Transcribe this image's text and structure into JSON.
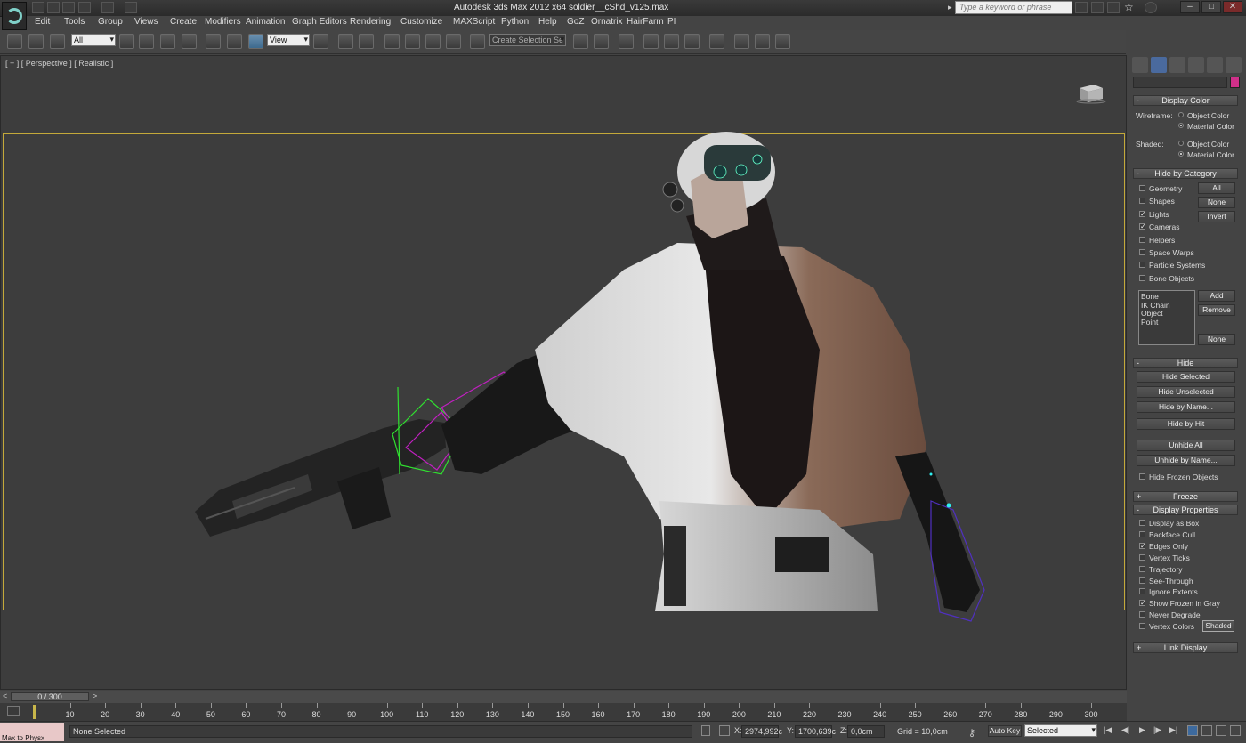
{
  "title_bar": {
    "title": "Autodesk 3ds Max  2012 x64      soldier__cShd_v125.max",
    "search_placeholder": "Type a keyword or phrase"
  },
  "menu": [
    "Edit",
    "Tools",
    "Group",
    "Views",
    "Create",
    "Modifiers",
    "Animation",
    "Graph Editors",
    "Rendering",
    "Customize",
    "MAXScript",
    "Python",
    "Help",
    "GoZ",
    "Ornatrix",
    "HairFarm",
    "PI"
  ],
  "toolbar": {
    "selection_filter": "All",
    "reference_coord": "View",
    "named_selection": "Create Selection Se"
  },
  "viewport": {
    "label": "[ + ] [ Perspective ] [ Realistic ]"
  },
  "timeline": {
    "frame_display": "0 / 300",
    "ticks": [
      "10",
      "20",
      "30",
      "40",
      "50",
      "60",
      "70",
      "80",
      "90",
      "100",
      "110",
      "120",
      "130",
      "140",
      "150",
      "160",
      "170",
      "180",
      "190",
      "200",
      "210",
      "220",
      "230",
      "240",
      "250",
      "260",
      "270",
      "280",
      "290",
      "300"
    ]
  },
  "status": {
    "selection": "None Selected",
    "x_label": "X:",
    "x_value": "2974,992c",
    "y_label": "Y:",
    "y_value": "1700,639c",
    "z_label": "Z:",
    "z_value": "0,0cm",
    "grid": "Grid = 10,0cm",
    "auto_key": "Auto Key",
    "key_filter": "Selected",
    "script_listener": "Max to Physx"
  },
  "command_panel": {
    "color_swatch": "#d0308a",
    "display_color": {
      "title": "Display Color",
      "wireframe_label": "Wireframe:",
      "shaded_label": "Shaded:",
      "object_color": "Object Color",
      "material_color": "Material Color"
    },
    "hide_by_category": {
      "title": "Hide by Category",
      "items": [
        {
          "label": "Geometry",
          "checked": false
        },
        {
          "label": "Shapes",
          "checked": false
        },
        {
          "label": "Lights",
          "checked": true
        },
        {
          "label": "Cameras",
          "checked": true
        },
        {
          "label": "Helpers",
          "checked": false
        },
        {
          "label": "Space Warps",
          "checked": false
        },
        {
          "label": "Particle Systems",
          "checked": false
        },
        {
          "label": "Bone Objects",
          "checked": false
        }
      ],
      "buttons": [
        "All",
        "None",
        "Invert"
      ],
      "list": [
        "Bone",
        "IK Chain Object",
        "Point"
      ],
      "list_buttons": [
        "Add",
        "Remove",
        "None"
      ]
    },
    "hide": {
      "title": "Hide",
      "buttons": [
        "Hide Selected",
        "Hide Unselected",
        "Hide by Name...",
        "Hide by Hit",
        "Unhide All",
        "Unhide by Name..."
      ],
      "hide_frozen": "Hide Frozen Objects"
    },
    "freeze": {
      "title": "Freeze"
    },
    "display_properties": {
      "title": "Display Properties",
      "items": [
        {
          "label": "Display as Box",
          "checked": false
        },
        {
          "label": "Backface Cull",
          "checked": false
        },
        {
          "label": "Edges Only",
          "checked": true
        },
        {
          "label": "Vertex Ticks",
          "checked": false
        },
        {
          "label": "Trajectory",
          "checked": false
        },
        {
          "label": "See-Through",
          "checked": false
        },
        {
          "label": "Ignore Extents",
          "checked": false
        },
        {
          "label": "Show Frozen in Gray",
          "checked": true
        },
        {
          "label": "Never Degrade",
          "checked": false
        },
        {
          "label": "Vertex Colors",
          "checked": false
        }
      ],
      "shaded_button": "Shaded"
    },
    "link_display": {
      "title": "Link Display"
    }
  },
  "colors": {
    "safe_frame": "#c4a93a",
    "viewport_bg": "#3d3d3d",
    "bone_magenta": "#c020c0",
    "bone_green": "#30e030",
    "bone_purple": "#5030c0"
  },
  "icons": [
    "app-logo-icon",
    "link-icon",
    "unlink-icon",
    "bind-space-warp-icon",
    "select-object-icon",
    "select-by-name-icon",
    "rect-region-icon",
    "window-crossing-icon",
    "move-icon",
    "rotate-icon",
    "scale-icon",
    "pivot-icon",
    "snap-3d-icon",
    "angle-snap-icon",
    "percent-snap-icon",
    "spinner-snap-icon",
    "edit-named-selection-icon",
    "mirror-icon",
    "align-icon",
    "layer-manager-icon",
    "graphite-icon",
    "curve-editor-icon",
    "schematic-view-icon",
    "material-editor-icon",
    "render-setup-icon",
    "rendered-frame-icon",
    "render-icon",
    "viewcube-icon",
    "create-tab-icon",
    "modify-tab-icon",
    "hierarchy-tab-icon",
    "motion-tab-icon",
    "display-tab-icon",
    "utilities-tab-icon"
  ]
}
